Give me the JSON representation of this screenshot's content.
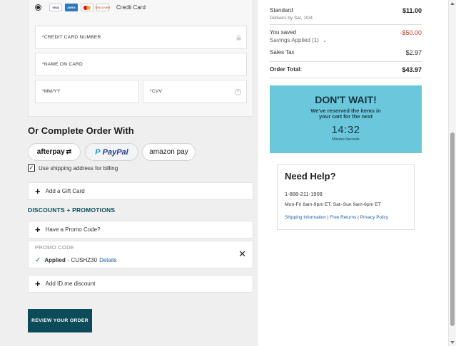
{
  "payment": {
    "credit_card_label": "Credit Card",
    "card_logos": [
      "VISA",
      "AMEX",
      "MC",
      "DISCOVER"
    ],
    "fields": {
      "card_number": "*CREDIT CARD NUMBER",
      "name_on_card": "*NAME ON CARD",
      "expiry": "*MM/YY",
      "cvv": "*CVV"
    }
  },
  "alt_pay": {
    "title": "Or Complete Order With",
    "afterpay": "afterpay",
    "paypal": "PayPal",
    "amazon": "amazon pay"
  },
  "billing": {
    "checkbox_label": "Use shipping address for billing",
    "checked": true
  },
  "gift_card": {
    "label": "Add a Gift Card"
  },
  "discounts": {
    "title": "DISCOUNTS + PROMOTIONS",
    "promo_label": "Have a Promo Code?",
    "promo_code_header": "PROMO CODE",
    "applied_label": "Applied",
    "applied_code": "- CUSHZ30",
    "details_link": "Details",
    "idme_label": "Add ID.me discount"
  },
  "review_button": "REVIEW YOUR ORDER",
  "summary": {
    "shipping_label": "Standard",
    "shipping_value": "$11.00",
    "shipping_eta": "Delivers by Sat, 10/4",
    "saved_label": "You saved",
    "saved_value": "-$50.00",
    "savings_applied": "Savings Applied (1)",
    "tax_label": "Sales Tax",
    "tax_value": "$2.97",
    "total_label": "Order Total:",
    "total_value": "$43.97"
  },
  "banner": {
    "title": "DON'T WAIT!",
    "line1": "We've reserved the items in",
    "line2": "your cart for the next",
    "time": "14:32",
    "units": "Minutes   Seconds"
  },
  "help": {
    "title": "Need Help?",
    "phone": "1-888-211-1908",
    "hours": "Mon-Fri 8am-9pm ET, Sat–Sun 9am-6pm ET",
    "links": [
      "Shipping Information",
      "Free Returns",
      "Privacy Policy"
    ]
  },
  "colors": {
    "brand_teal": "#0c4c5a",
    "banner_bg": "#6bc7dc",
    "savings_red": "#c0392b",
    "link_blue": "#1a5fa6"
  }
}
